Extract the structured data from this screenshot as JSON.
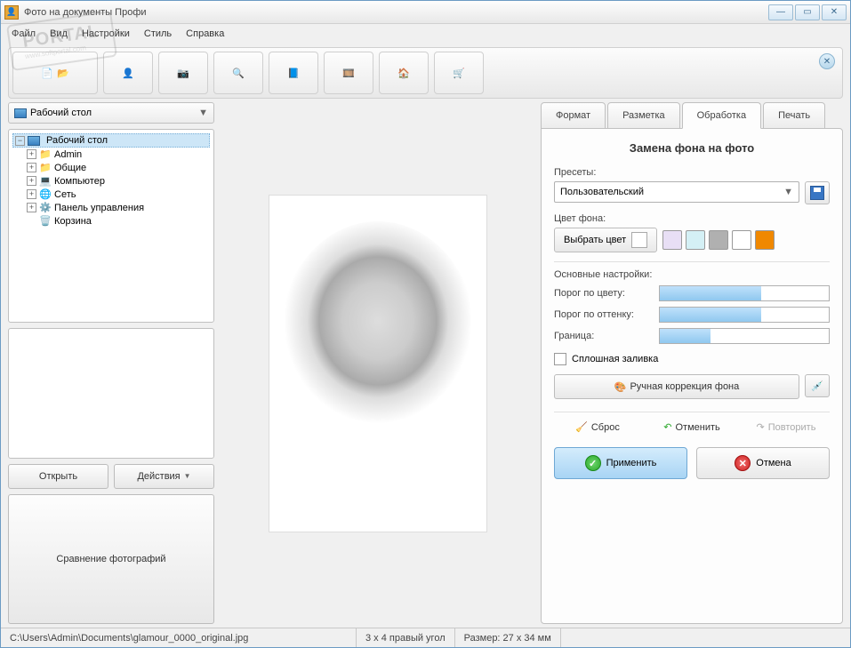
{
  "window": {
    "title": "Фото на документы Профи"
  },
  "menu": {
    "file": "Файл",
    "view": "Вид",
    "settings": "Настройки",
    "style": "Стиль",
    "help": "Справка"
  },
  "toolbar_icons": {
    "new": "folder-document-icon",
    "open": "folder-open-icon",
    "user": "user-search-icon",
    "camera": "camera-icon",
    "zoom": "photo-zoom-icon",
    "help": "help-book-icon",
    "film": "film-reel-icon",
    "home": "home-icon",
    "cart": "shopping-cart-icon"
  },
  "left": {
    "path_selector": "Рабочий стол",
    "tree": {
      "root": "Рабочий стол",
      "children": [
        "Admin",
        "Общие",
        "Компьютер",
        "Сеть",
        "Панель управления",
        "Корзина"
      ]
    },
    "btn_open": "Открыть",
    "btn_actions": "Действия",
    "btn_compare": "Сравнение фотографий"
  },
  "tabs": {
    "format": "Формат",
    "layout": "Разметка",
    "processing": "Обработка",
    "print": "Печать"
  },
  "panel": {
    "title": "Замена фона на фото",
    "presets_label": "Пресеты:",
    "preset_value": "Пользовательский",
    "bgcolor_label": "Цвет фона:",
    "pick_color": "Выбрать цвет",
    "current_color": "#ffffff",
    "swatches": [
      "#e8dff5",
      "#d4f0f5",
      "#b0b0b0",
      "#ffffff",
      "#f08800"
    ],
    "main_settings_label": "Основные настройки:",
    "slider_color": "Порог по цвету:",
    "slider_hue": "Порог по оттенку:",
    "slider_border": "Граница:",
    "slider_values": {
      "color": 60,
      "hue": 60,
      "border": 30
    },
    "solid_fill": "Сплошная заливка",
    "manual": "Ручная коррекция фона",
    "reset": "Сброс",
    "undo": "Отменить",
    "redo": "Повторить",
    "apply": "Применить",
    "cancel": "Отмена"
  },
  "status": {
    "path": "C:\\Users\\Admin\\Documents\\glamour_0000_original.jpg",
    "format": "3 x 4 правый угол",
    "size": "Размер: 27 x 34 мм"
  },
  "watermark": {
    "main": "PORTAL",
    "sub": "www.softportal.com"
  }
}
